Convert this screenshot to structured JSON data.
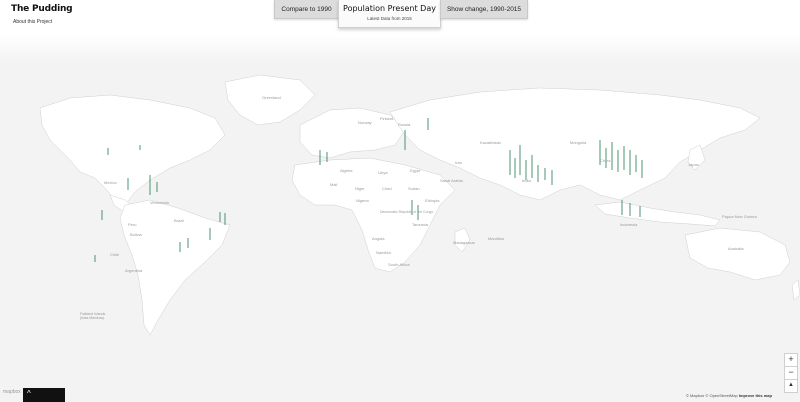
{
  "header": {
    "brand": "The Pudding",
    "about_link": "About this Project"
  },
  "tabs": {
    "left": "Compare to 1990",
    "active_title": "Population Present Day",
    "active_subtitle": "Latest Data from 2015",
    "right": "Show change, 1990-2015"
  },
  "map_labels": {
    "greenland": "Greenland",
    "russia": "Russia",
    "finland": "Finland",
    "norway": "Norway",
    "kazakhstan": "Kazakhstan",
    "mongolia": "Mongolia",
    "china": "China",
    "india": "India",
    "iran": "Iran",
    "saudi_arabia": "Saudi Arabia",
    "egypt": "Egypt",
    "libya": "Libya",
    "algeria": "Algeria",
    "mali": "Mali",
    "niger": "Niger",
    "chad": "Chad",
    "sudan": "Sudan",
    "ethiopia": "Ethiopia",
    "nigeria": "Nigeria",
    "drc": "Democratic Republic of the Congo",
    "tanzania": "Tanzania",
    "angola": "Angola",
    "namibia": "Namibia",
    "south_africa": "South Africa",
    "madagascar": "Madagascar",
    "mauritius": "Mauritius",
    "brazil": "Brazil",
    "peru": "Peru",
    "bolivia": "Bolivia",
    "argentina": "Argentina",
    "chile": "Chile",
    "falkland": "Falkland Islands (Islas Malvinas)",
    "australia": "Australia",
    "mexico": "Mexico",
    "venezuela": "Venezuela",
    "japan": "Japan",
    "indonesia": "Indonesia",
    "papua": "Papua New Guinea"
  },
  "controls": {
    "zoom_in": "+",
    "zoom_out": "−",
    "compass": "▲",
    "toggle": "^"
  },
  "attribution": {
    "text": "© Mapbox © OpenStreetMap",
    "improve": "Improve this map"
  },
  "logo_text": "mapbox",
  "colors": {
    "accent_green": "#1e7a4c",
    "land": "#ffffff",
    "water": "#f2f2f2"
  }
}
